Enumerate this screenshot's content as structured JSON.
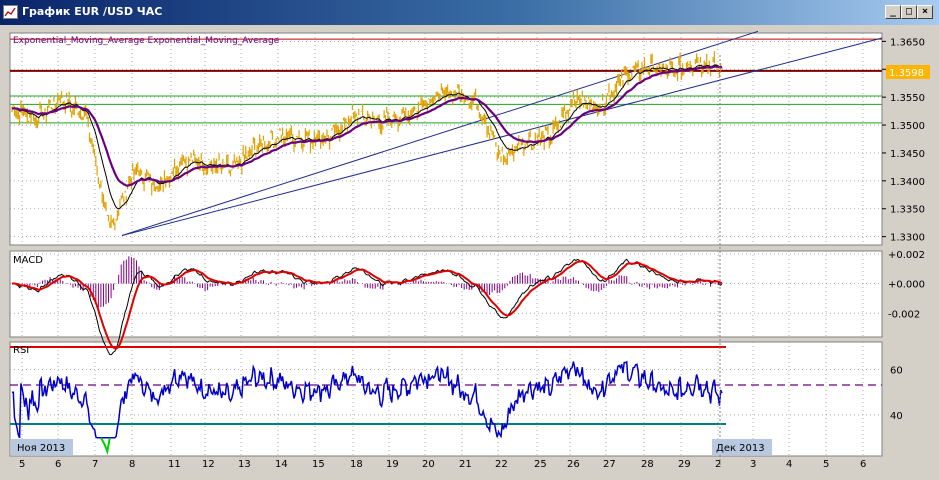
{
  "window": {
    "title": "График EUR /USD  ЧАС",
    "buttons": [
      "minimize",
      "maximize",
      "close"
    ]
  },
  "colors": {
    "background": "#ffffff",
    "grid": "#9a9a9a",
    "price": "#e0a000",
    "ema_fast": "#000000",
    "ema_slow": "#6a0080",
    "trendline": "#1c2c8c",
    "horizontal_red": "#c00000",
    "horizontal_maroon": "#800000",
    "horizontal_green": "#20a020",
    "macd_hist": "#800080",
    "macd_signal": "#e00000",
    "rsi_line": "#0000c8",
    "rsi_spike": "#00d000",
    "rsi_upper": "#e00000",
    "rsi_lower": "#008080",
    "rsi_mid": "#6a0080",
    "price_label_bg": "#ffb400"
  },
  "chart_data": [
    {
      "type": "line",
      "name": "main",
      "indicator_label": "Exponential_Moving_Average Exponential_Moving_Average",
      "y_ticks": [
        "1.3650",
        "1.3600",
        "1.3550",
        "1.3500",
        "1.3450",
        "1.3400",
        "1.3350",
        "1.3300"
      ],
      "ylim": [
        1.3285,
        1.3665
      ],
      "current_price_label": "1.3598",
      "horizontal_levels": [
        {
          "value": 1.3654,
          "color": "red"
        },
        {
          "value": 1.3597,
          "color": "maroon"
        },
        {
          "value": 1.3552,
          "color": "green"
        },
        {
          "value": 1.3537,
          "color": "green"
        },
        {
          "value": 1.3504,
          "color": "green"
        }
      ],
      "price_series": {
        "x": [
          5,
          6,
          7,
          7.8,
          8,
          9,
          10,
          11,
          12,
          13,
          14,
          15,
          16,
          17,
          18,
          19,
          20,
          21,
          22,
          23,
          24,
          25,
          26,
          27,
          28,
          29,
          30,
          31,
          32,
          33
        ],
        "values": [
          1.353,
          1.3512,
          1.3547,
          1.352,
          1.331,
          1.342,
          1.339,
          1.344,
          1.343,
          1.342,
          1.346,
          1.348,
          1.3475,
          1.3478,
          1.352,
          1.3505,
          1.3515,
          1.3545,
          1.356,
          1.354,
          1.344,
          1.347,
          1.348,
          1.355,
          1.353,
          1.359,
          1.3605,
          1.3595,
          1.3615,
          1.36
        ]
      },
      "trendlines": [
        {
          "from": [
            8,
            1.3302
          ],
          "to": [
            34,
            1.3668
          ]
        },
        {
          "from": [
            8,
            1.3302
          ],
          "to": [
            34,
            1.3652
          ]
        }
      ]
    },
    {
      "type": "line",
      "name": "MACD",
      "label": "MACD",
      "y_ticks": [
        "+0.002",
        "+0.000",
        "-0.002"
      ],
      "ylim": [
        -0.0036,
        0.0022
      ]
    },
    {
      "type": "line",
      "name": "RSI",
      "label": "RSI",
      "y_ticks": [
        "60",
        "40"
      ],
      "ylim": [
        22,
        72
      ],
      "levels": {
        "upper": 70,
        "mid": 50,
        "lower": 30
      }
    }
  ],
  "x_axis": {
    "tick_labels": [
      "5",
      "6",
      "7",
      "8",
      "11",
      "12",
      "13",
      "14",
      "15",
      "18",
      "19",
      "20",
      "21",
      "22",
      "25",
      "26",
      "27",
      "28",
      "29",
      "2",
      "3",
      "4",
      "5",
      "6"
    ],
    "month_labels": [
      "Ноя 2013",
      "Дек 2013"
    ]
  }
}
